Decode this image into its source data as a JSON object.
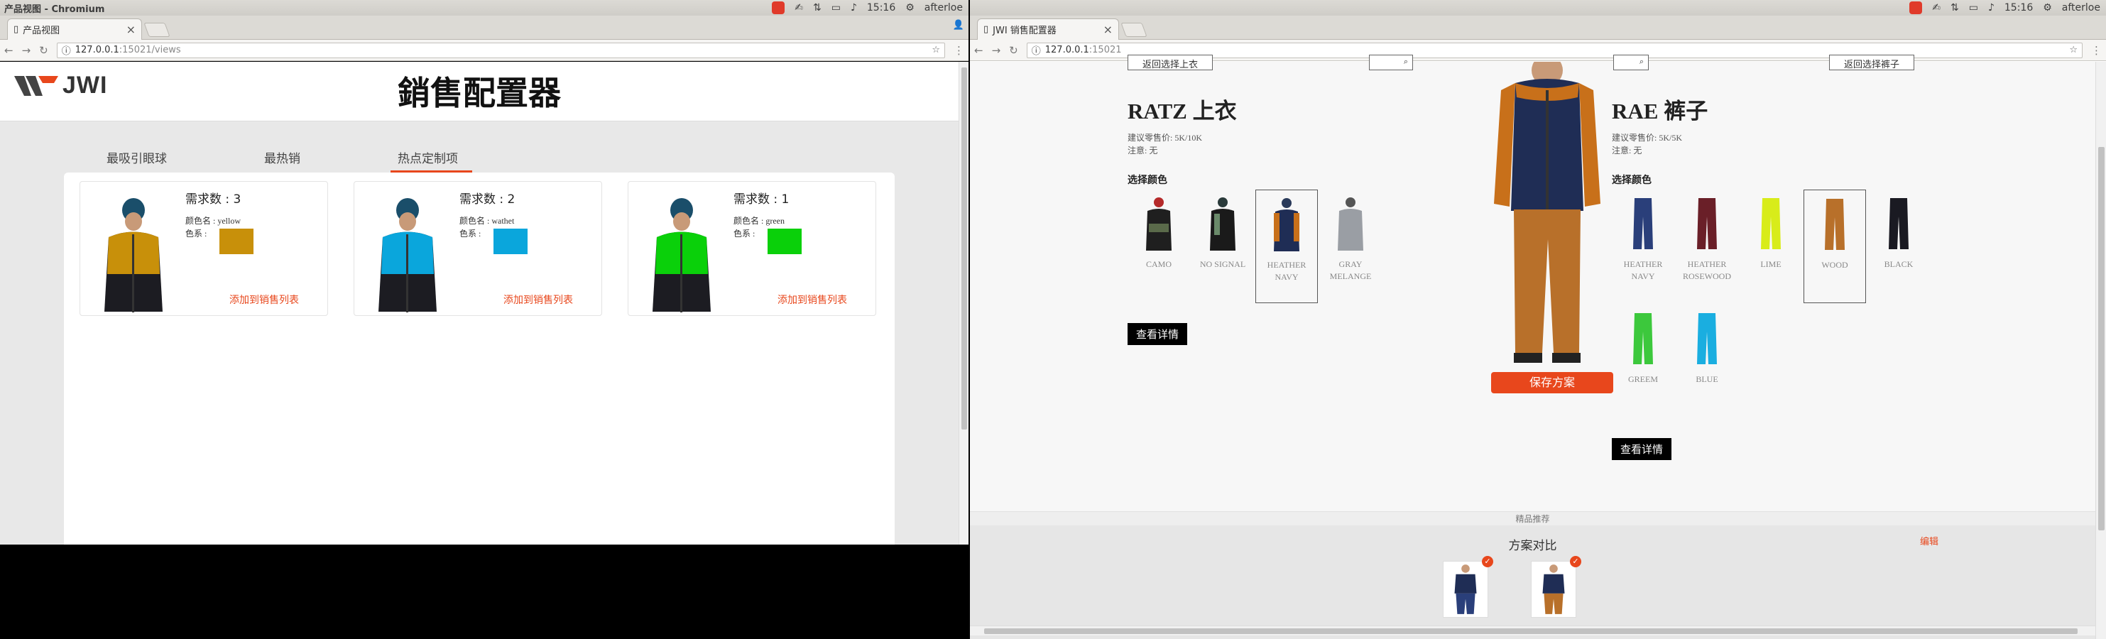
{
  "left": {
    "window_title": "产品视图 - Chromium",
    "tab_title": "产品视图",
    "url_host": "127.0.0.1",
    "url_rest": ":15021/views",
    "clock": "15:16",
    "user": "afterloe",
    "logo": "JWI",
    "page_title": "銷售配置器",
    "tabs": [
      "最吸引眼球",
      "最热销",
      "热点定制项"
    ],
    "active_tab": 2,
    "cards": [
      {
        "count": "需求数 : 3",
        "color_name": "颜色名 : yellow",
        "swatch_label": "色系 :",
        "swatch": "#c8900a",
        "add": "添加到销售列表"
      },
      {
        "count": "需求数 : 2",
        "color_name": "颜色名 : wathet",
        "swatch_label": "色系 :",
        "swatch": "#0aa6dc",
        "add": "添加到销售列表"
      },
      {
        "count": "需求数 : 1",
        "color_name": "颜色名 : green",
        "swatch_label": "色系 :",
        "swatch": "#0ad00a",
        "add": "添加到销售列表"
      }
    ]
  },
  "right": {
    "tab_title": "JWI 销售配置器",
    "url_host": "127.0.0.1",
    "url_rest": ":15021",
    "clock": "15:16",
    "user": "afterloe",
    "top_left_btn": "返回选择上衣",
    "top_right_btn": "返回选择裤子",
    "top_left_stub": "返回",
    "top_right_stub": "返回",
    "jacket": {
      "name": "RATZ 上衣",
      "price": "建议零售价: 5K/10K",
      "note": "注意: 无",
      "color_title": "选择颜色",
      "options": [
        {
          "label": "CAMO",
          "selected": false
        },
        {
          "label": "NO SIGNAL",
          "selected": false
        },
        {
          "label": "HEATHER NAVY",
          "selected": true
        },
        {
          "label": "GRAY MELANGE",
          "selected": false
        }
      ],
      "detail": "查看详情"
    },
    "pants": {
      "name": "RAE 裤子",
      "price": "建议零售价: 5K/5K",
      "note": "注意: 无",
      "color_title": "选择颜色",
      "options": [
        {
          "label": "HEATHER NAVY",
          "selected": false
        },
        {
          "label": "HEATHER ROSEWOOD",
          "selected": false
        },
        {
          "label": "LIME",
          "selected": false
        },
        {
          "label": "WOOD",
          "selected": true
        },
        {
          "label": "BLACK",
          "selected": false
        },
        {
          "label": "GREEM",
          "selected": false
        },
        {
          "label": "BLUE",
          "selected": false
        }
      ],
      "detail": "查看详情"
    },
    "save_button": "保存方案",
    "recommend": "精品推荐",
    "compare_title": "方案对比",
    "compare_edit": "编辑",
    "compare_check": "✓"
  },
  "colors": {
    "accent": "#e8471c"
  },
  "icons": [
    "back-icon",
    "forward-icon",
    "reload-icon",
    "info-icon",
    "star-icon",
    "menu-icon",
    "close-icon",
    "user-icon",
    "check-icon"
  ]
}
